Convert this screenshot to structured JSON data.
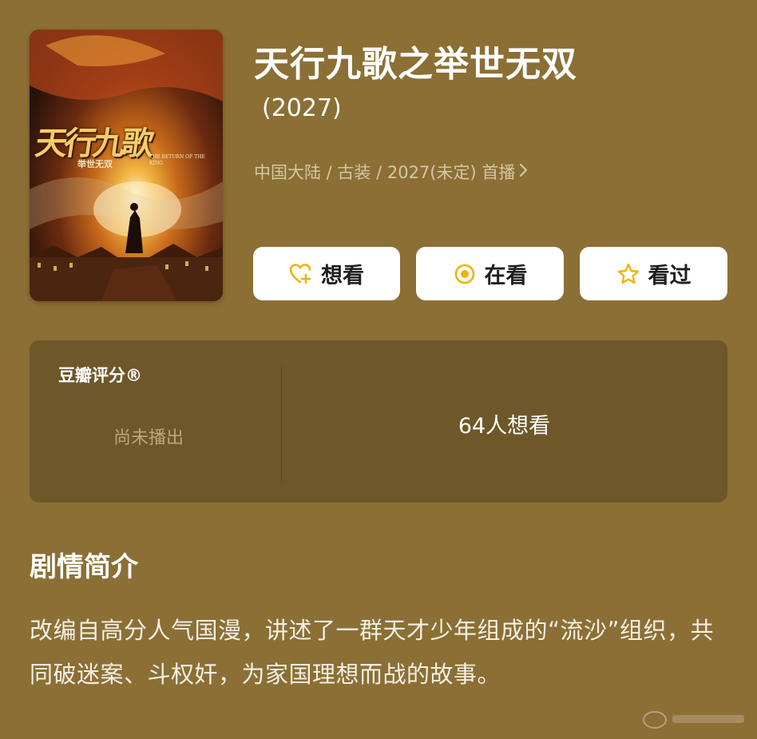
{
  "poster": {
    "title_text": "天行九歌",
    "sub_text": "举世无双",
    "en_text": "THE RETURN OF THE KING"
  },
  "header": {
    "title": "天行九歌之举世无双",
    "year": "(2027)",
    "meta": "中国大陆 / 古装 / 2027(未定) 首播"
  },
  "actions": [
    {
      "label": "想看",
      "icon": "heart-plus-icon"
    },
    {
      "label": "在看",
      "icon": "target-circle-icon"
    },
    {
      "label": "看过",
      "icon": "star-icon"
    }
  ],
  "rating": {
    "label": "豆瓣评分®",
    "status": "尚未播出",
    "want_count": "64人想看"
  },
  "synopsis": {
    "title": "剧情简介",
    "text": "改编自高分人气国漫，讲述了一群天才少年组成的“流沙”组织，共同破迷案、斗权奸，为家国理想而战的故事。"
  },
  "colors": {
    "background": "#8b6f35",
    "card": "#6e5728",
    "accent": "#f0b400",
    "muted_text": "#d5c6a3"
  }
}
